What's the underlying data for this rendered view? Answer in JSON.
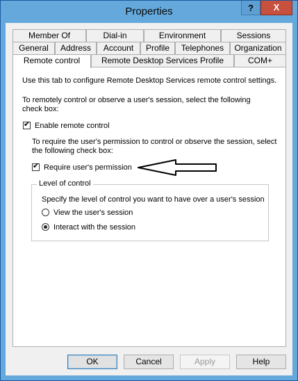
{
  "window": {
    "title": "Properties",
    "help_glyph": "?",
    "close_glyph": "X"
  },
  "tabs_row1": [
    "Member Of",
    "Dial-in",
    "Environment",
    "Sessions"
  ],
  "tabs_row2": [
    "General",
    "Address",
    "Account",
    "Profile",
    "Telephones",
    "Organization"
  ],
  "tabs_row3": [
    "Remote control",
    "Remote Desktop Services Profile",
    "COM+"
  ],
  "active_tab": "Remote control",
  "panel": {
    "intro": "Use this tab to configure Remote Desktop Services remote control settings.",
    "enable_desc_line1": "To remotely control or observe a user's session, select the following",
    "enable_desc_line2": "check box:",
    "enable_label": "Enable remote control",
    "enable_checked": true,
    "permission_desc_line1": "To require the user's permission to control or observe the session, select",
    "permission_desc_line2": "the following check box:",
    "permission_label": "Require user's permission",
    "permission_checked": true,
    "level_group": {
      "legend": "Level of control",
      "desc": "Specify the level of control you want to have over a user's session",
      "options": [
        {
          "label": "View the user's session",
          "selected": false
        },
        {
          "label": "Interact with the session",
          "selected": true
        }
      ]
    }
  },
  "buttons": {
    "ok": "OK",
    "cancel": "Cancel",
    "apply": "Apply",
    "help": "Help"
  },
  "colors": {
    "titlebar": "#64a8dc",
    "close_button": "#c7503f",
    "dialog_bg": "#f0f0f0"
  }
}
